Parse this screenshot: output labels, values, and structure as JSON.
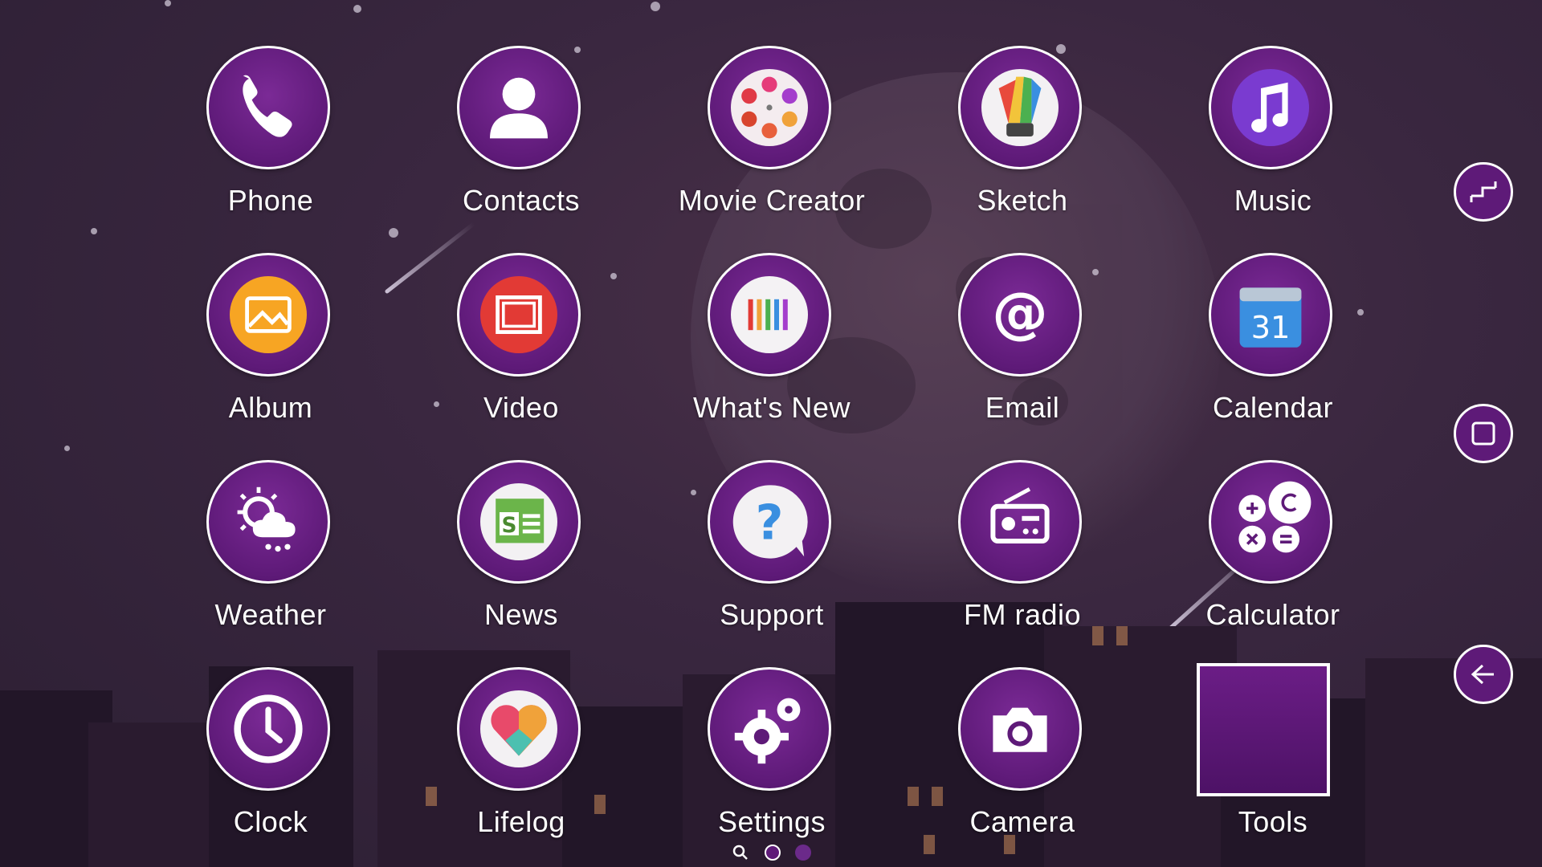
{
  "theme": {
    "accent": "#5e1a78",
    "ring": "#ffffff",
    "label_color": "#ffffff"
  },
  "apps": [
    {
      "label": "Phone",
      "icon": "phone-icon"
    },
    {
      "label": "Contacts",
      "icon": "contacts-icon"
    },
    {
      "label": "Movie Creator",
      "icon": "film-reel-icon"
    },
    {
      "label": "Sketch",
      "icon": "sketch-icon"
    },
    {
      "label": "Music",
      "icon": "music-note-icon"
    },
    {
      "label": "Album",
      "icon": "album-icon"
    },
    {
      "label": "Video",
      "icon": "video-icon"
    },
    {
      "label": "What's New",
      "icon": "whats-new-icon"
    },
    {
      "label": "Email",
      "icon": "at-sign-icon"
    },
    {
      "label": "Calendar",
      "icon": "calendar-icon",
      "badge": "31"
    },
    {
      "label": "Weather",
      "icon": "weather-icon"
    },
    {
      "label": "News",
      "icon": "news-icon",
      "badge": "S"
    },
    {
      "label": "Support",
      "icon": "question-icon"
    },
    {
      "label": "FM radio",
      "icon": "radio-icon"
    },
    {
      "label": "Calculator",
      "icon": "calculator-icon"
    },
    {
      "label": "Clock",
      "icon": "clock-icon"
    },
    {
      "label": "Lifelog",
      "icon": "heart-icon"
    },
    {
      "label": "Settings",
      "icon": "gear-icon"
    },
    {
      "label": "Camera",
      "icon": "camera-icon"
    },
    {
      "label": "Tools",
      "icon": "folder-icon"
    }
  ],
  "nav_buttons": [
    {
      "icon": "recent-apps-icon"
    },
    {
      "icon": "home-icon"
    },
    {
      "icon": "back-icon"
    }
  ],
  "pager": {
    "items": [
      "search-icon",
      "page-indicator-current",
      "page-indicator"
    ],
    "current": 1
  }
}
